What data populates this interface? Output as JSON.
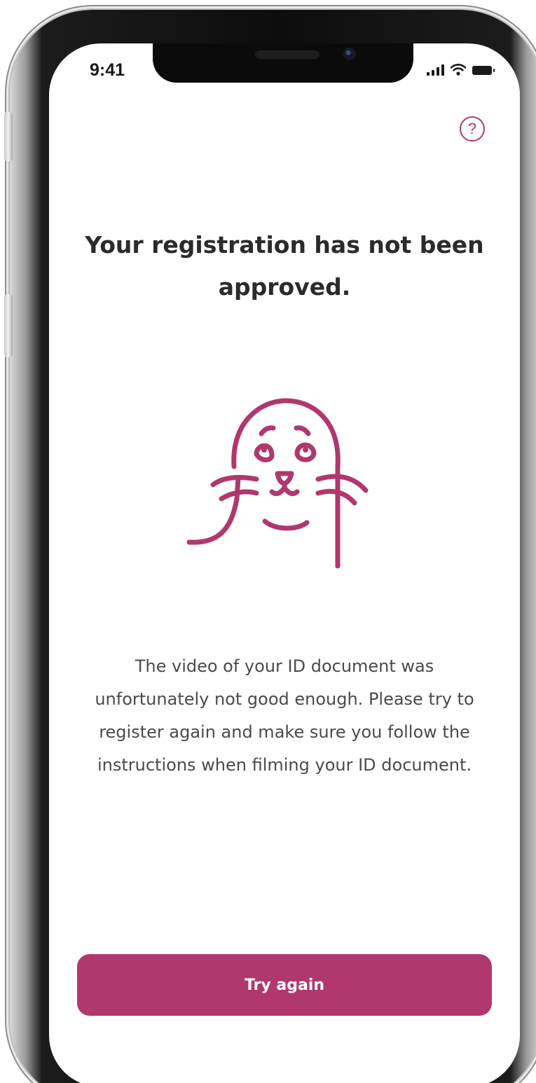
{
  "status_bar": {
    "time": "9:41",
    "icons": [
      "cellular-signal-icon",
      "wifi-icon",
      "battery-icon"
    ]
  },
  "header": {
    "help_icon": "question-circle-icon",
    "help_symbol": "?"
  },
  "content": {
    "title": "Your registration has not been approved.",
    "illustration": "sad-seal-illustration",
    "message": "The video of your ID document was unfortunately not good enough. Please try to register again and make sure you follow the instructions when filming your ID document."
  },
  "actions": {
    "primary_label": "Try again"
  },
  "colors": {
    "accent": "#b0386d",
    "title_text": "#2b2b2b",
    "body_text": "#4a4a4a",
    "button_text": "#ffffff",
    "background": "#ffffff"
  }
}
